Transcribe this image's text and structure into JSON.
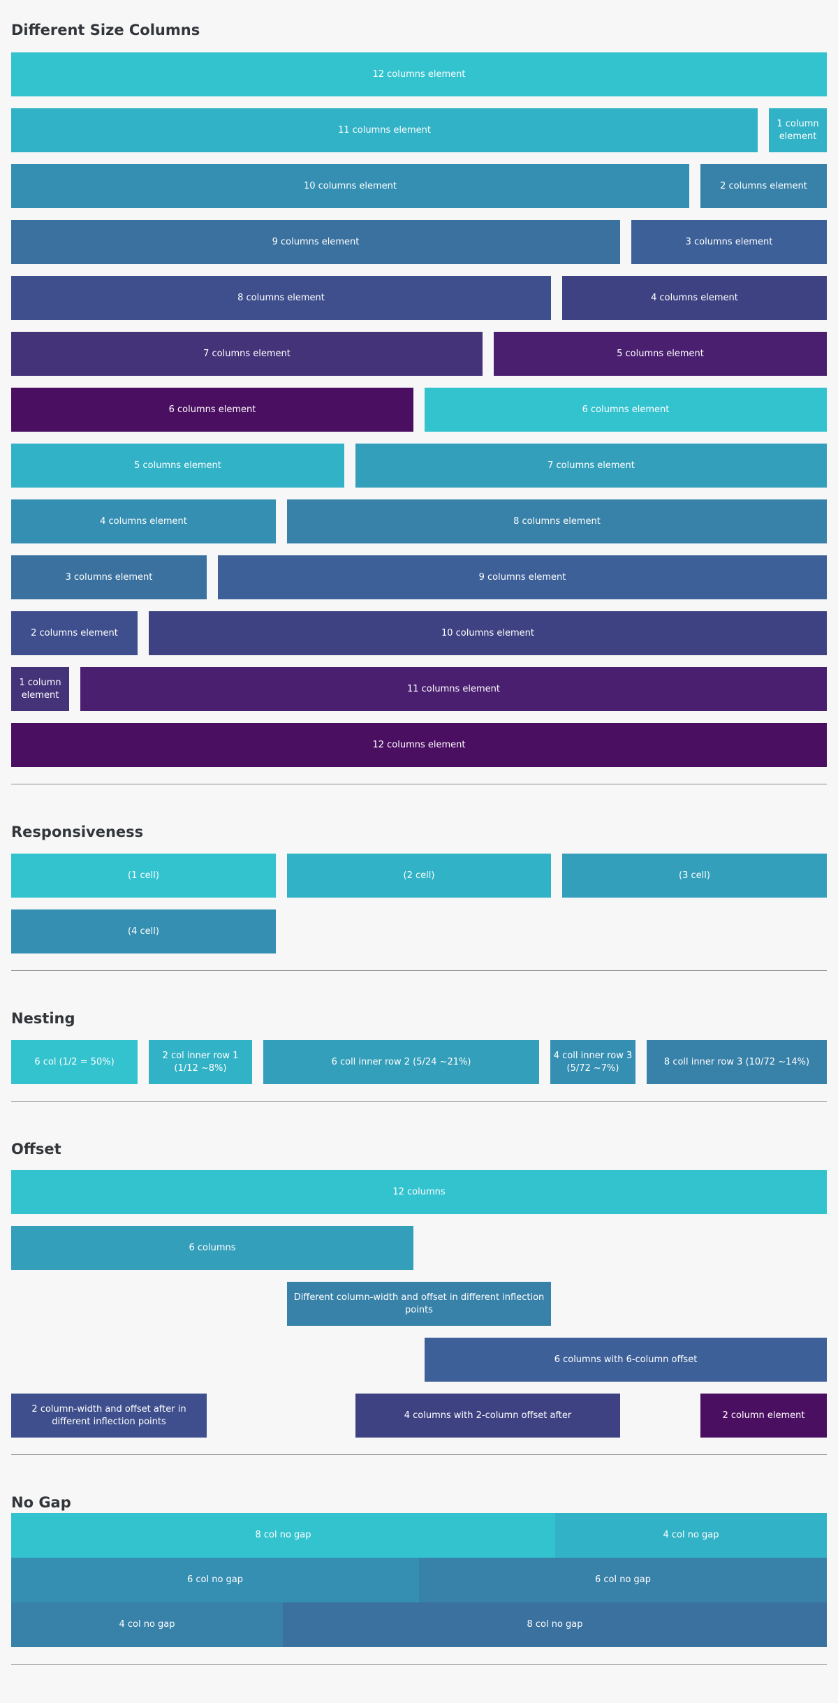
{
  "sections": {
    "different_size_columns": {
      "title": "Different Size Columns",
      "rows": [
        [
          "12 columns element"
        ],
        [
          "11 columns element",
          "1 column element"
        ],
        [
          "10 columns element",
          "2 columns element"
        ],
        [
          "9 columns element",
          "3 columns element"
        ],
        [
          "8 columns element",
          "4 columns element"
        ],
        [
          "7 columns element",
          "5 columns element"
        ],
        [
          "6 columns element",
          "6 columns element"
        ],
        [
          "5 columns element",
          "7 columns element"
        ],
        [
          "4 columns element",
          "8 columns element"
        ],
        [
          "3 columns element",
          "9 columns element"
        ],
        [
          "2 columns element",
          "10 columns element"
        ],
        [
          "1 column element",
          "11 columns element"
        ],
        [
          "12 columns element"
        ]
      ]
    },
    "responsiveness": {
      "title": "Responsiveness",
      "cells": [
        "(1 cell)",
        "(2 cell)",
        "(3 cell)",
        "(4 cell)"
      ]
    },
    "nesting": {
      "title": "Nesting",
      "cells": [
        "6 col (1/2 = 50%)",
        "2 col inner row 1 (1/12 ~8%)",
        "6 coll inner row 2 (5/24 ~21%)",
        "4 coll inner row 3 (5/72 ~7%)",
        "8 coll inner row 3 (10/72 ~14%)"
      ]
    },
    "offset": {
      "title": "Offset",
      "cells": [
        "12 columns",
        "6 columns",
        "Different column-width and offset in different inflection points",
        "6 columns with 6-column offset",
        "2 column-width and offset after in different inflection points",
        "4 columns with 2-column offset after",
        "2 column element"
      ]
    },
    "no_gap": {
      "title": "No Gap",
      "cells": [
        "8 col no gap",
        "4 col no gap",
        "6 col no gap",
        "6 col no gap",
        "4 col no gap",
        "8 col no gap"
      ]
    }
  },
  "colors": {
    "background": "#f7f7f7",
    "heading": "#32363a",
    "separator": "#8a8d90",
    "palette": [
      "#33c3cf",
      "#32b2c6",
      "#349fbb",
      "#358fb2",
      "#3881a8",
      "#3a719f",
      "#3d6099",
      "#3f4f8d",
      "#3f4282",
      "#443379",
      "#4a1f70",
      "#4b0f62"
    ]
  }
}
